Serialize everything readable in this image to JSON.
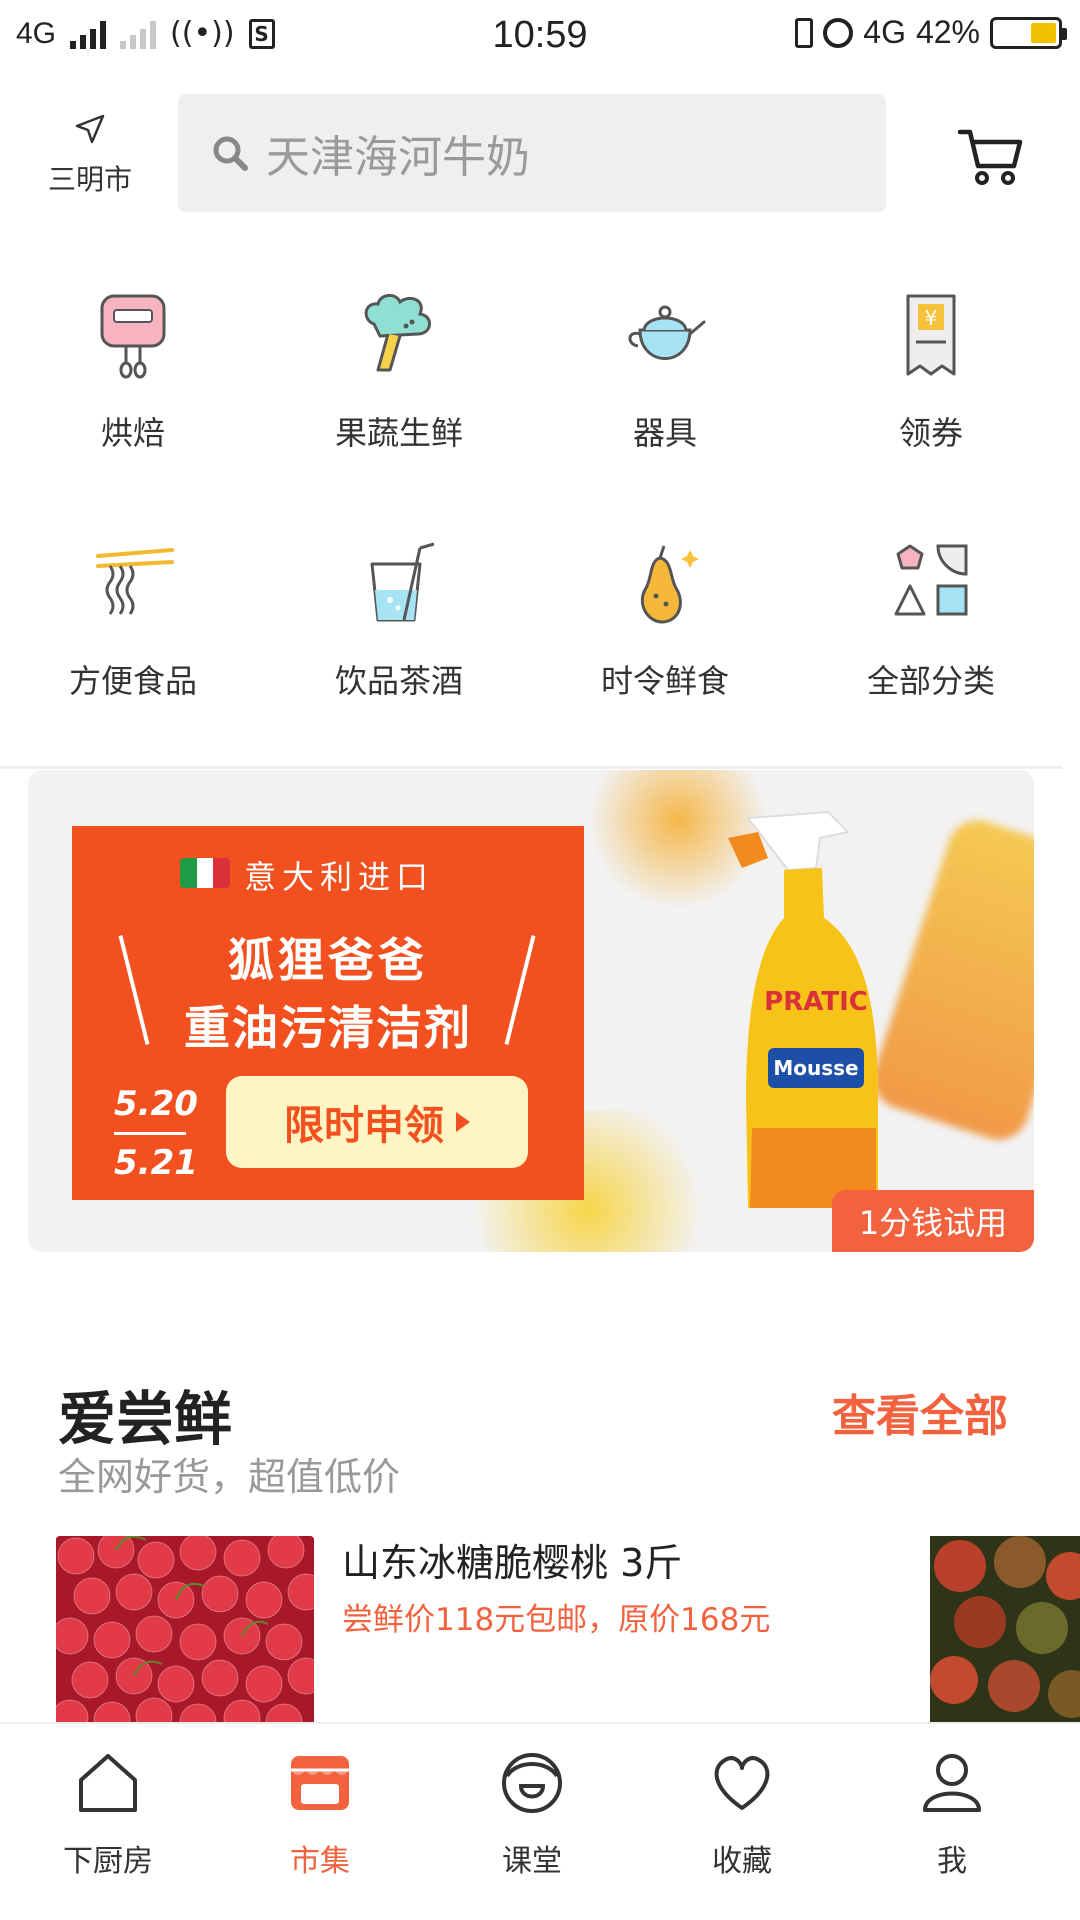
{
  "status_bar": {
    "network_left": "4G",
    "time": "10:59",
    "network_right": "4G",
    "battery": "42%",
    "battery_level": 0.42
  },
  "header": {
    "location_icon": "navigation-arrow-icon",
    "location": "三明市",
    "search_placeholder": "天津海河牛奶",
    "cart_icon": "shopping-cart-icon"
  },
  "categories": [
    {
      "label": "烘焙",
      "icon": "mixer-icon"
    },
    {
      "label": "果蔬生鲜",
      "icon": "broccoli-icon"
    },
    {
      "label": "器具",
      "icon": "teapot-icon"
    },
    {
      "label": "领券",
      "icon": "coupon-icon"
    },
    {
      "label": "方便食品",
      "icon": "noodles-icon"
    },
    {
      "label": "饮品茶酒",
      "icon": "drink-icon"
    },
    {
      "label": "时令鲜食",
      "icon": "pear-icon"
    },
    {
      "label": "全部分类",
      "icon": "shapes-icon"
    }
  ],
  "banner": {
    "origin": "意大利进口",
    "product_line1": "狐狸爸爸",
    "product_line2": "重油污清洁剂",
    "date_start": "5.20",
    "date_end": "5.21",
    "cta": "限时申领",
    "badge": "1分钱试用",
    "colors": {
      "promo": "#f2501e",
      "cta_bg": "#fff4c4"
    }
  },
  "section": {
    "title": "爱尝鲜",
    "subtitle": "全网好货，超值低价",
    "view_all": "查看全部"
  },
  "products": [
    {
      "name": "山东冰糖脆樱桃 3斤",
      "price_text": "尝鲜价118元包邮，原价168元"
    }
  ],
  "tabbar": {
    "tabs": [
      {
        "label": "下厨房",
        "icon": "house-icon",
        "active": false
      },
      {
        "label": "市集",
        "icon": "market-icon",
        "active": true
      },
      {
        "label": "课堂",
        "icon": "classroom-icon",
        "active": false
      },
      {
        "label": "收藏",
        "icon": "heart-icon",
        "active": false
      },
      {
        "label": "我",
        "icon": "person-icon",
        "active": false
      }
    ]
  },
  "colors": {
    "accent": "#f2623e",
    "text": "#333333",
    "muted": "#999999"
  }
}
